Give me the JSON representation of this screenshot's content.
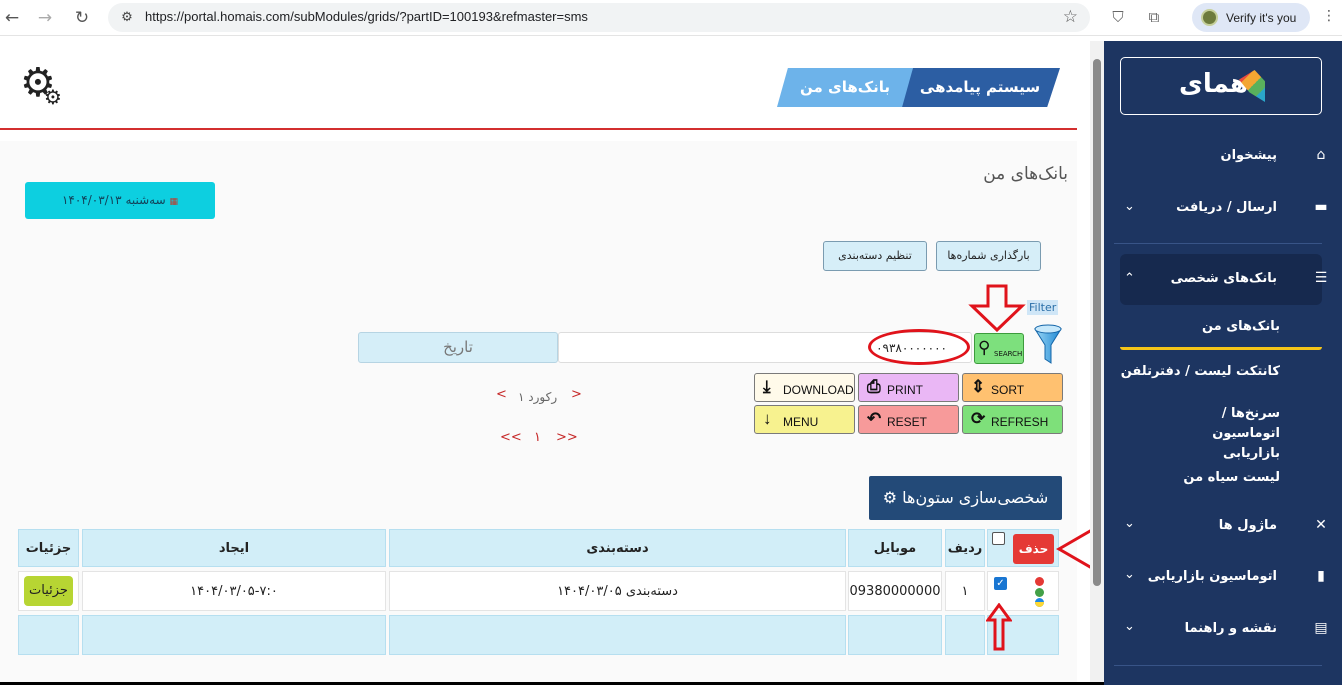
{
  "browser": {
    "url": "https://portal.homais.com/subModules/grids/?partID=100193&refmaster=sms",
    "verify_label": "Verify it's you"
  },
  "header": {
    "tab_system": "سیستم پیامدهی",
    "tab_banks": "بانک‌های من"
  },
  "page": {
    "title": "بانک‌های من",
    "date_label": "سه‌شنبه ۱۴۰۴/۰۳/۱۳"
  },
  "toolbar": {
    "upload_numbers": "بارگذاری شماره‌ها",
    "set_category": "تنظیم دسته‌بندی",
    "filter_label": "Filter",
    "search_label": "SEARCH",
    "search_value": "۰۹۳۸۰۰۰۰۰۰۰",
    "date_placeholder": "تاریخ"
  },
  "pager": {
    "prev": "<",
    "next": ">",
    "record_text": "۱ رکورد",
    "first": "<<",
    "last": ">>",
    "page": "۱"
  },
  "actions": {
    "download": "DOWNLOAD",
    "print": "PRINT",
    "sort": "SORT",
    "menu": "MENU",
    "reset": "RESET",
    "refresh": "REFRESH"
  },
  "customize_columns": "⚙ شخصی‌سازی ستون‌ها",
  "table": {
    "delete_button": "حذف",
    "headers": {
      "row": "ردیف",
      "mobile": "موبایل",
      "category": "دسته‌بندی",
      "created": "ایجاد",
      "details": "جزئیات"
    },
    "rows": [
      {
        "row": "۱",
        "mobile": "09380000000",
        "category": "دسته‌بندی ۱۴۰۴/۰۳/۰۵",
        "created": "۱۴۰۴/۰۳/۰۵-۷:۰",
        "details": "جزئیات",
        "checked": true
      }
    ]
  },
  "sidebar": {
    "logo": "همای",
    "items": [
      {
        "label": "پیشخوان",
        "icon": "home-icon"
      },
      {
        "label": "ارسال / دریافت",
        "icon": "message-icon"
      },
      {
        "label": "بانک‌های شخصی",
        "icon": "database-icon"
      },
      {
        "label": "ماژول ها",
        "icon": "tools-icon"
      },
      {
        "label": "اتوماسیون بازاریابی",
        "icon": "chart-icon"
      },
      {
        "label": "نقشه و راهنما",
        "icon": "map-icon"
      }
    ],
    "sub_items": [
      "بانک‌های من",
      "کانتکت لیست / دفترتلفن",
      "سرنخ‌ها / اتوماسیون بازاریابی",
      "لیست سیاه من"
    ]
  },
  "colors": {
    "sidebar_bg": "#1d3561",
    "accent_red": "#e0131b",
    "header_blue": "#2c5ea3",
    "cyan": "#0dcfe0"
  }
}
